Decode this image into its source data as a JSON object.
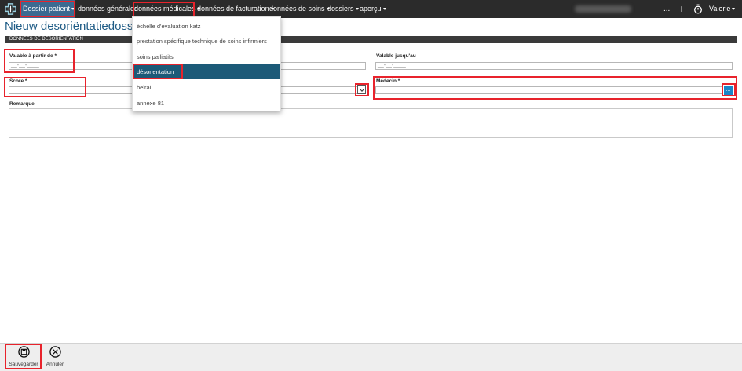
{
  "nav": {
    "dossier_patient": "Dossier patient",
    "donnees_generales": "données générales",
    "donnees_medicales": "données médicales",
    "donnees_facturation": "données de facturation",
    "donnees_soins": "données de soins",
    "dossiers": "dossiers",
    "apercu": "aperçu"
  },
  "toolbar": {
    "more": "...",
    "add": "+",
    "user_name": "Valerie"
  },
  "page": {
    "title": "Nieuw desoriëntatiedossier",
    "section_title": "DONNÉES DE DÉSORIENTATION"
  },
  "form": {
    "valable_a_partir_label": "Valable à partir de *",
    "valable_a_partir_value": "__-__-____",
    "valable_jusqu_label": "Valable jusqu'au",
    "valable_jusqu_value": "__-__-____",
    "score_label": "Score *",
    "medecin_label": "Médecin *",
    "medecin_button": "...",
    "remarque_label": "Remarque"
  },
  "dropdown": {
    "items": [
      "échelle d'évaluation katz",
      "prestation spécifique technique de soins infirmiers",
      "soins palliatifs",
      "désorientation",
      "belrai",
      "annexe 81"
    ]
  },
  "footer": {
    "save_label": "Sauvegarder",
    "cancel_label": "Annuler"
  },
  "colors": {
    "accent": "#1f5c86",
    "highlight": "#e8232c",
    "selected": "#1c5a78"
  }
}
